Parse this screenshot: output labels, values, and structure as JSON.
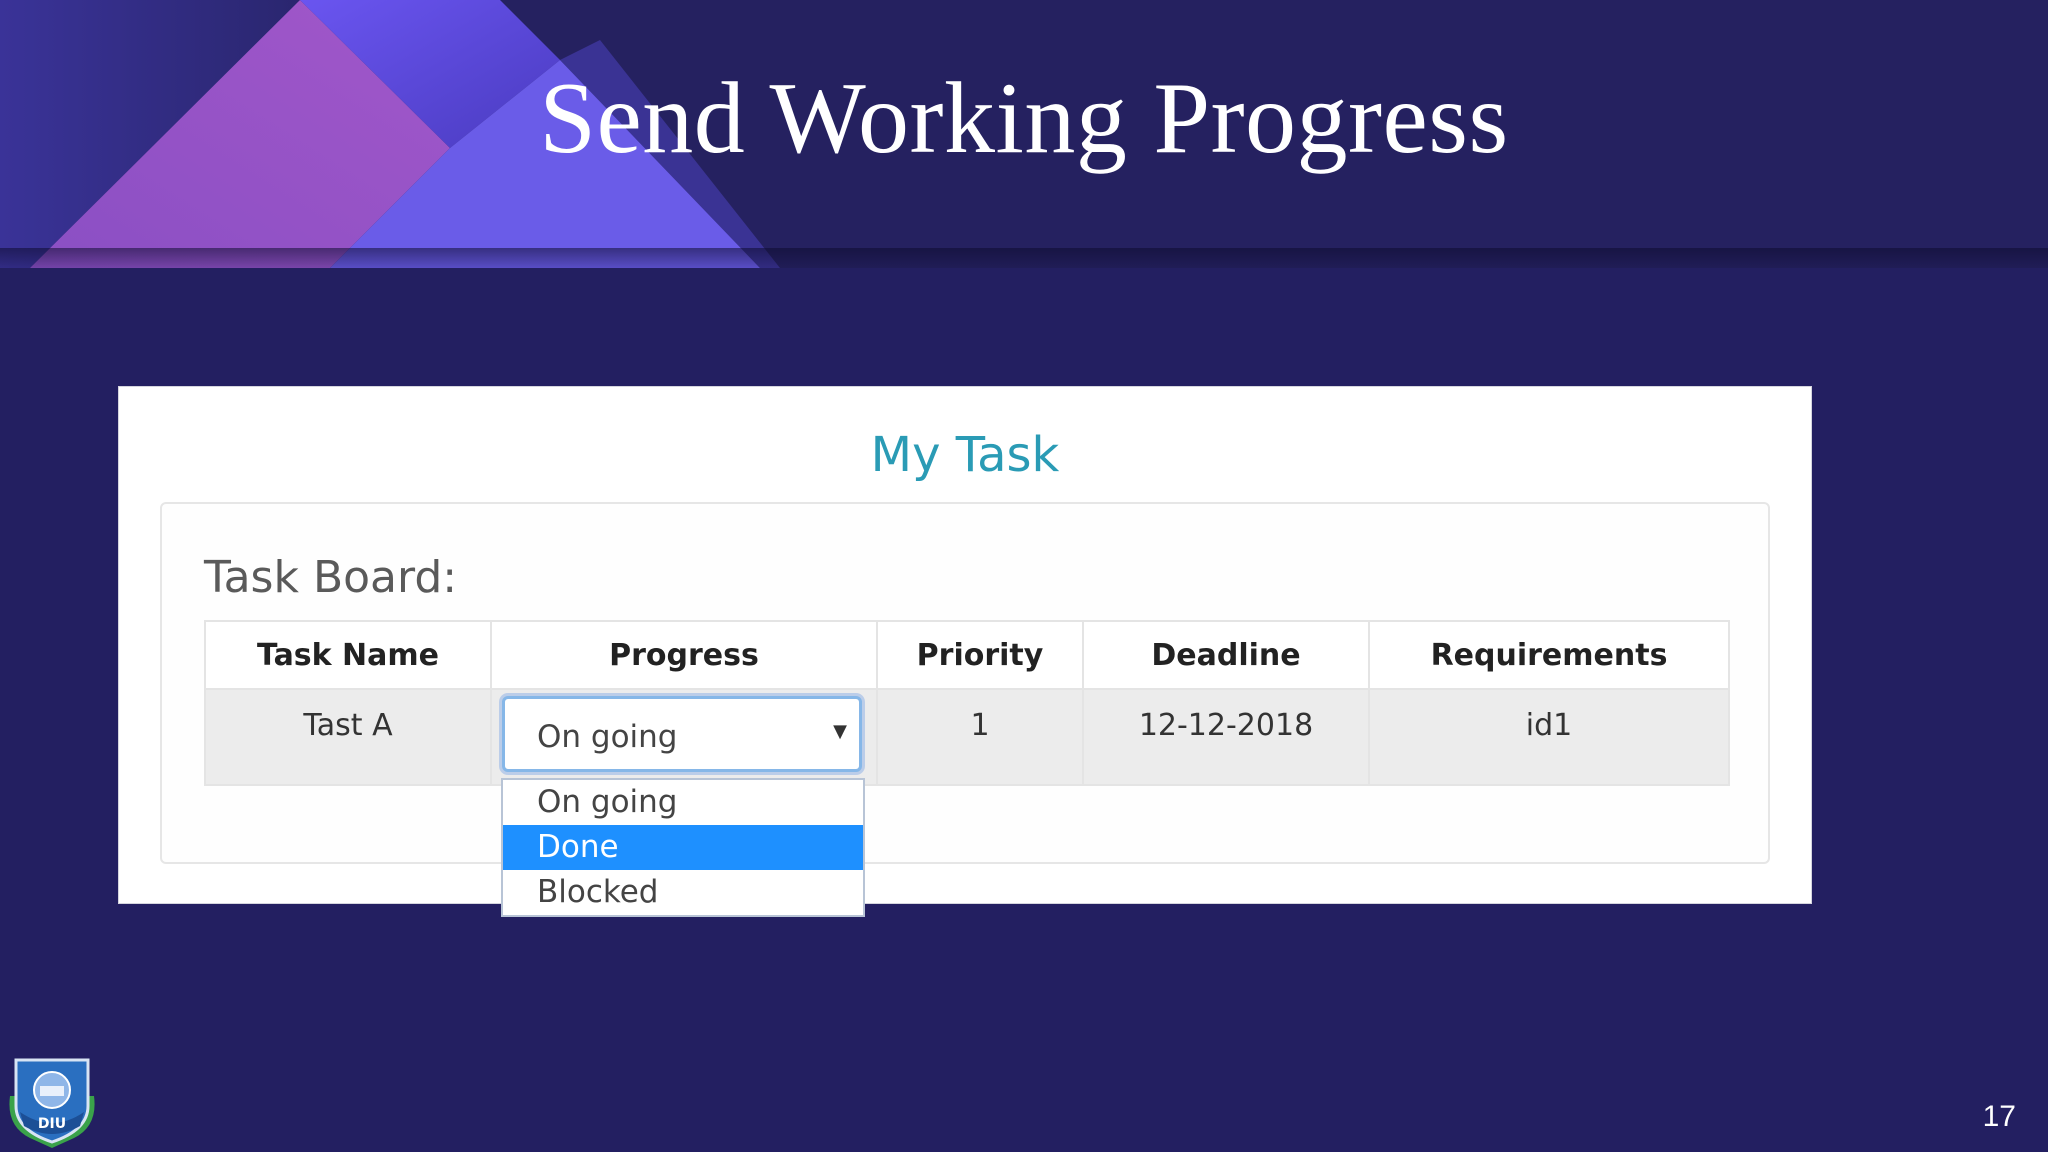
{
  "slide": {
    "title": "Send Working Progress",
    "page_number": "17"
  },
  "panel": {
    "title": "My Task",
    "board_label": "Task Board:"
  },
  "table": {
    "headers": [
      "Task Name",
      "Progress",
      "Priority",
      "Deadline",
      "Requirements"
    ],
    "rows": [
      {
        "task_name": "Tast A",
        "progress": "On going",
        "priority": "1",
        "deadline": "12-12-2018",
        "requirements": "id1"
      }
    ]
  },
  "progress_select": {
    "current_value": "On going",
    "options": [
      "On going",
      "Done",
      "Blocked"
    ],
    "highlighted_option": "Done"
  },
  "logo": {
    "text": "DIU"
  },
  "colors": {
    "background": "#231f61",
    "panel_title": "#2a9bb5",
    "highlight": "#1e90ff"
  },
  "icons": [
    "chevron-down-icon",
    "university-logo-icon"
  ]
}
